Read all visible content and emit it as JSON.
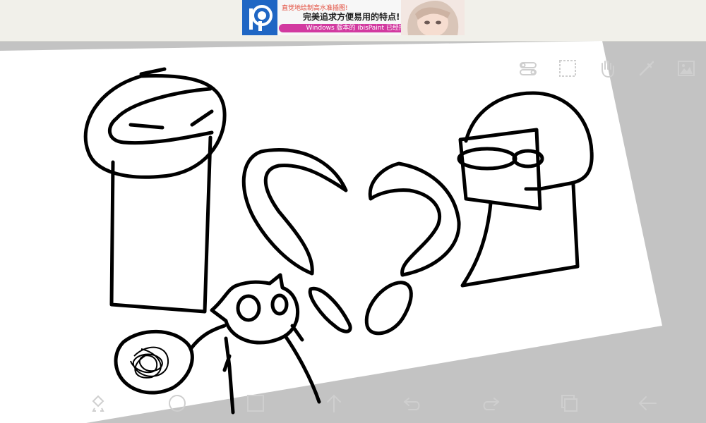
{
  "ad": {
    "line1": "直觉地绘制高水准插图!",
    "line2": "完美追求方便易用的特点!",
    "line3": "Windows 版本的 ibisPaint 已经推出!"
  },
  "colors": {
    "background": "#c3c3c3",
    "canvas": "#ffffff",
    "stroke": "#000000",
    "icon": "#cfcfcf",
    "ad_brand": "#1f66c4",
    "ad_banner": "#d23aa0"
  },
  "top_tools": [
    {
      "name": "toggle-settings-icon"
    },
    {
      "name": "selection-rect-icon"
    },
    {
      "name": "hand-pan-icon"
    },
    {
      "name": "eyedropper-icon"
    },
    {
      "name": "image-gallery-icon"
    }
  ],
  "bottom_tools": [
    {
      "name": "transform-rotate-icon"
    },
    {
      "name": "circle-icon"
    },
    {
      "name": "square-icon"
    },
    {
      "name": "arrow-up-icon"
    },
    {
      "name": "undo-icon"
    },
    {
      "name": "redo-icon"
    },
    {
      "name": "layers-icon"
    },
    {
      "name": "back-arrow-icon"
    }
  ]
}
